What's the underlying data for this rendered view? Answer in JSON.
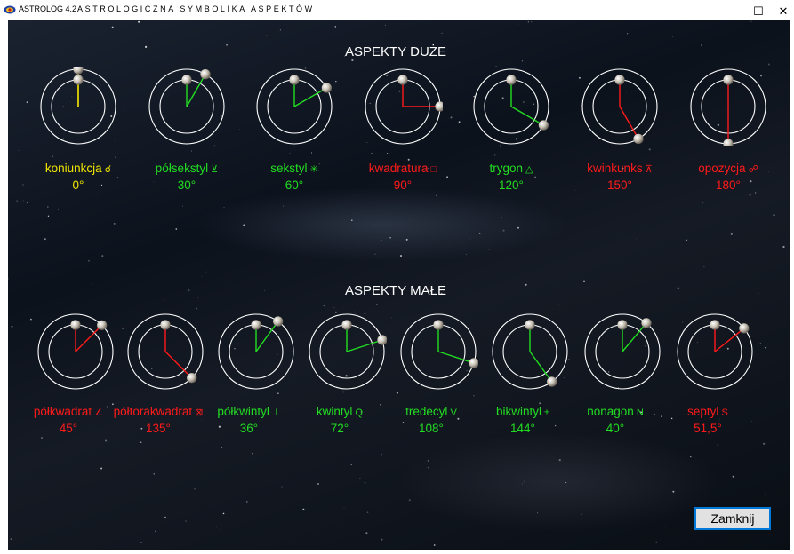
{
  "window": {
    "app_name": "ASTROLOG 4.2",
    "title": "ASTROLOGICZNA SYMBOLIKA ASPEKTÓW",
    "minimize": "—",
    "maximize": "☐",
    "close": "✕"
  },
  "sections": {
    "major_title": "ASPEKTY DUŻE",
    "minor_title": "ASPEKTY MAŁE"
  },
  "colors": {
    "yellow": "#f2e600",
    "green": "#22dd22",
    "red": "#ff1a1a"
  },
  "major_aspects": [
    {
      "name": "koniunkcja",
      "symbol": "☌",
      "degrees": "0°",
      "angle": 0,
      "color": "yellow"
    },
    {
      "name": "półsekstyl",
      "symbol": "⊻",
      "degrees": "30°",
      "angle": 30,
      "color": "green"
    },
    {
      "name": "sekstyl",
      "symbol": "✳",
      "degrees": "60°",
      "angle": 60,
      "color": "green"
    },
    {
      "name": "kwadratura",
      "symbol": "□",
      "degrees": "90°",
      "angle": 90,
      "color": "red"
    },
    {
      "name": "trygon",
      "symbol": "△",
      "degrees": "120°",
      "angle": 120,
      "color": "green"
    },
    {
      "name": "kwinkunks",
      "symbol": "⊼",
      "degrees": "150°",
      "angle": 150,
      "color": "red"
    },
    {
      "name": "opozycja",
      "symbol": "☍",
      "degrees": "180°",
      "angle": 180,
      "color": "red"
    }
  ],
  "minor_aspects": [
    {
      "name": "półkwadrat",
      "symbol": "∠",
      "degrees": "45°",
      "angle": 45,
      "color": "red"
    },
    {
      "name": "półtorakwadrat",
      "symbol": "⊠",
      "degrees": "135°",
      "angle": 135,
      "color": "red"
    },
    {
      "name": "półkwintyl",
      "symbol": "⊥",
      "degrees": "36°",
      "angle": 36,
      "color": "green"
    },
    {
      "name": "kwintyl",
      "symbol": "Q",
      "degrees": "72°",
      "angle": 72,
      "color": "green"
    },
    {
      "name": "tredecyl",
      "symbol": "V",
      "degrees": "108°",
      "angle": 108,
      "color": "green"
    },
    {
      "name": "bikwintyl",
      "symbol": "±",
      "degrees": "144°",
      "angle": 144,
      "color": "green"
    },
    {
      "name": "nonagon",
      "symbol": "N",
      "degrees": "40°",
      "angle": 40,
      "color": "green"
    },
    {
      "name": "septyl",
      "symbol": "S",
      "degrees": "51,5°",
      "angle": 51.5,
      "color": "red"
    }
  ],
  "buttons": {
    "close_label": "Zamknij"
  }
}
